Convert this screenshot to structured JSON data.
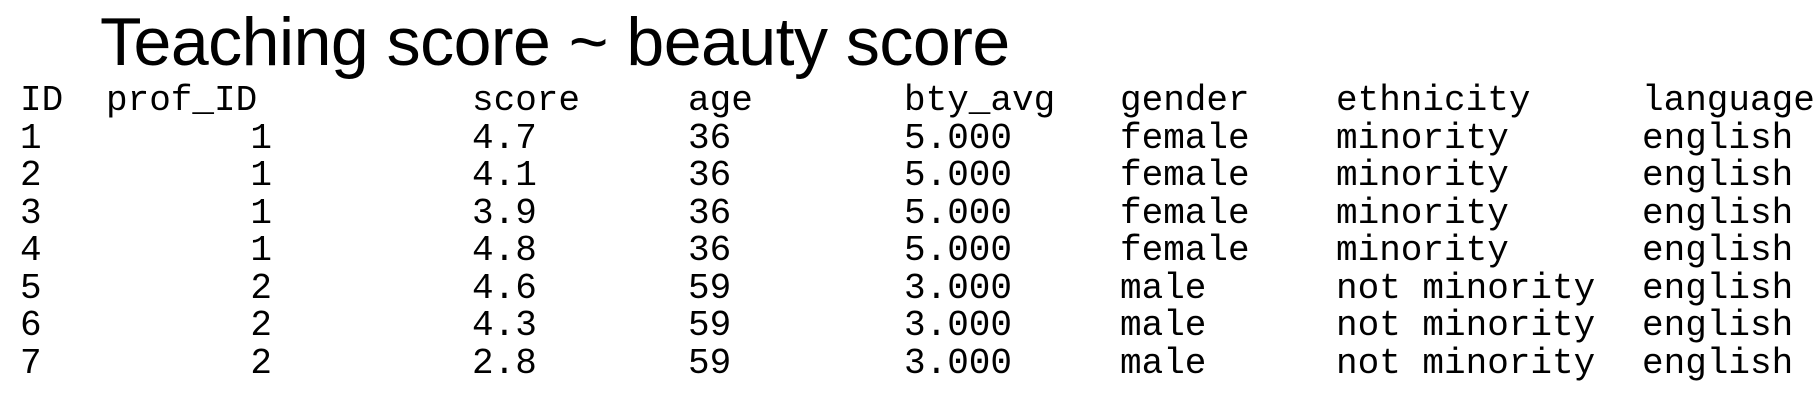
{
  "title": "Teaching score ~ beauty score",
  "table": {
    "columns": [
      "ID",
      "prof_ID",
      "score",
      "age",
      "bty_avg",
      "gender",
      "ethnicity",
      "language"
    ],
    "rows": [
      [
        "1",
        "1",
        "4.7",
        "36",
        "5.000",
        "female",
        "minority",
        "english"
      ],
      [
        "2",
        "1",
        "4.1",
        "36",
        "5.000",
        "female",
        "minority",
        "english"
      ],
      [
        "3",
        "1",
        "3.9",
        "36",
        "5.000",
        "female",
        "minority",
        "english"
      ],
      [
        "4",
        "1",
        "4.8",
        "36",
        "5.000",
        "female",
        "minority",
        "english"
      ],
      [
        "5",
        "2",
        "4.6",
        "59",
        "3.000",
        "male",
        "not minority",
        "english"
      ],
      [
        "6",
        "2",
        "4.3",
        "59",
        "3.000",
        "male",
        "not minority",
        "english"
      ],
      [
        "7",
        "2",
        "2.8",
        "59",
        "3.000",
        "male",
        "not minority",
        "english"
      ]
    ]
  }
}
